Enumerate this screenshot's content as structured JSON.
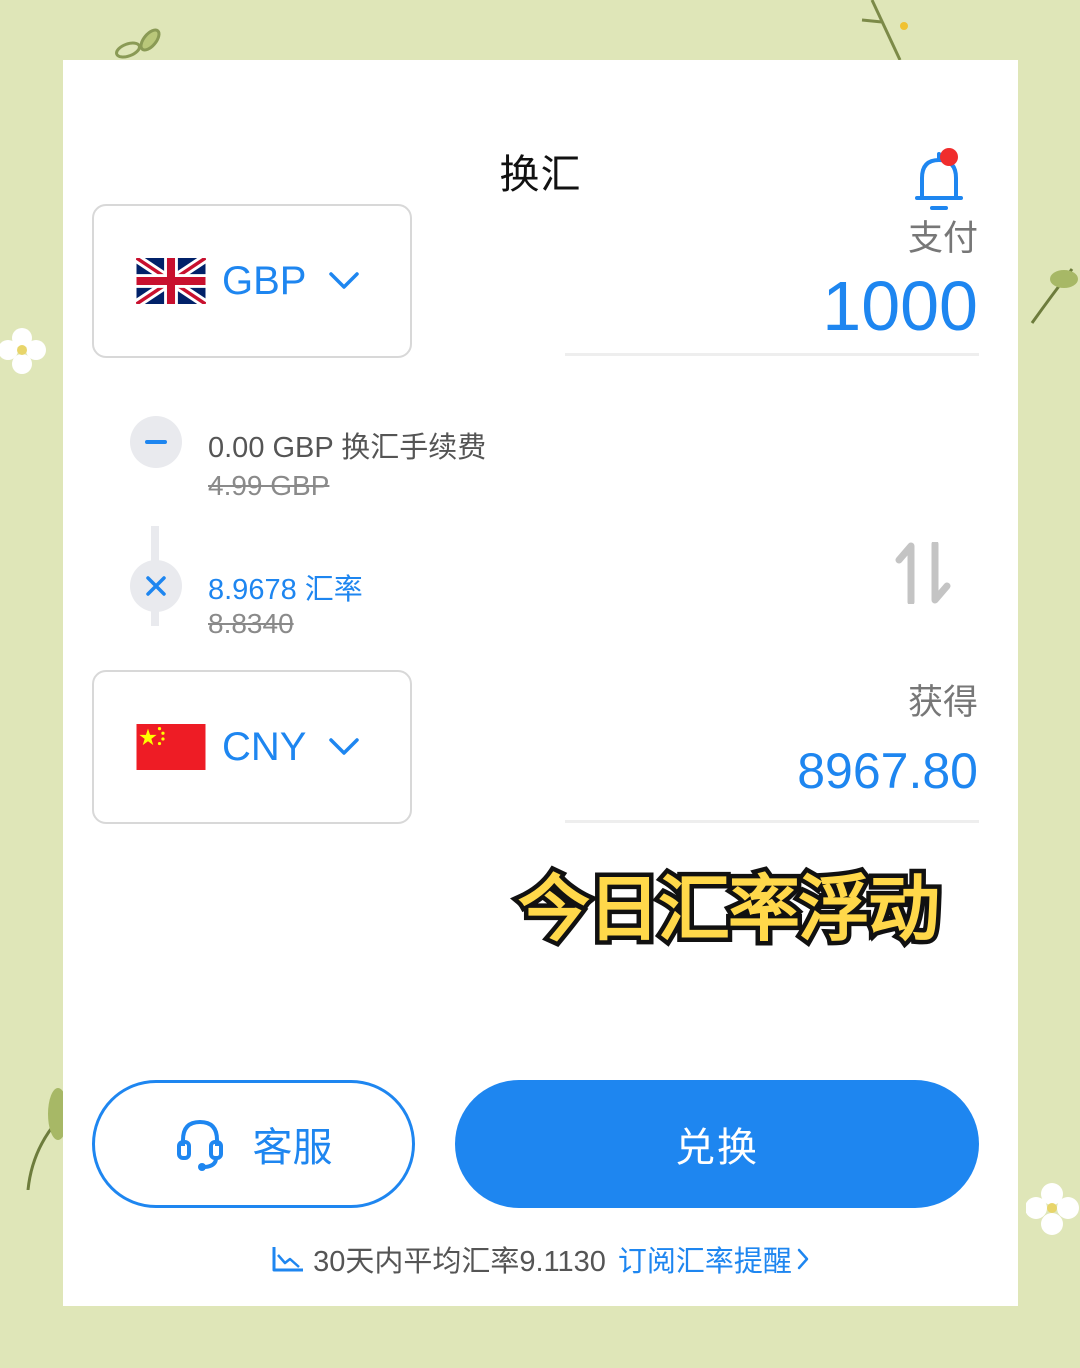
{
  "header": {
    "title": "换汇"
  },
  "pay": {
    "currency": "GBP",
    "label": "支付",
    "amount": "1000"
  },
  "fee": {
    "text": "0.00 GBP 换汇手续费",
    "original": "4.99 GBP"
  },
  "rate": {
    "text": "8.9678 汇率",
    "original": "8.8340"
  },
  "receive": {
    "currency": "CNY",
    "label": "获得",
    "amount": "8967.80"
  },
  "banner": "今日汇率浮动",
  "buttons": {
    "service": "客服",
    "exchange": "兑换"
  },
  "footer": {
    "average": "30天内平均汇率9.1130",
    "subscribe": "订阅汇率提醒"
  },
  "colors": {
    "accent": "#1e86f0",
    "background": "#dfe6b8",
    "banner_fill": "#ffd84a",
    "notification_dot": "#f02d2d"
  },
  "icons": [
    "bell-icon",
    "uk-flag-icon",
    "china-flag-icon",
    "chevron-down-icon",
    "minus-icon",
    "times-icon",
    "swap-icon",
    "headset-icon",
    "trend-chart-icon",
    "chevron-right-icon"
  ]
}
